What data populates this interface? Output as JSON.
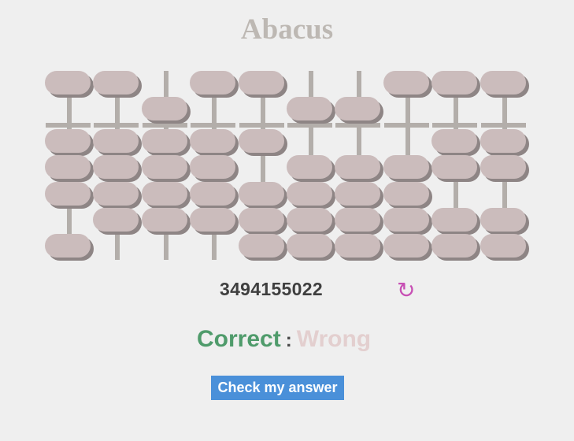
{
  "title": "Abacus",
  "number": "3494155022",
  "reset_icon": "refresh-icon",
  "score": {
    "correct_label": "Correct",
    "separator": ":",
    "wrong_label": "Wrong"
  },
  "check_button_label": "Check my answer",
  "colors": {
    "bead": "#cbbcbc",
    "bead_shadow": "#8e8585",
    "rod": "#b3aeaa",
    "correct": "#4f9b6b",
    "wrong": "#e3cfcf",
    "button": "#4a90d9",
    "reset_icon": "#c74fb4"
  },
  "abacus": {
    "rods": 10,
    "upper_beads_per_rod": 1,
    "lower_beads_per_rod": 4,
    "digits": [
      3,
      4,
      9,
      4,
      1,
      5,
      5,
      0,
      2,
      2
    ]
  }
}
